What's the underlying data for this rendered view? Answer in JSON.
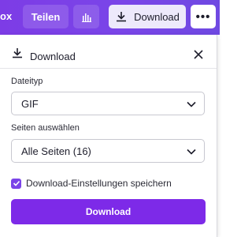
{
  "toolbar": {
    "cut_text": "ox",
    "share_label": "Teilen",
    "download_label": "Download",
    "more_label": "•••"
  },
  "panel": {
    "title": "Download",
    "file_type": {
      "label": "Dateityp",
      "value": "GIF"
    },
    "pages": {
      "label": "Seiten auswählen",
      "value": "Alle Seiten (16)"
    },
    "save_settings": {
      "label": "Download-Einstellungen speichern",
      "checked": true
    },
    "primary_button": "Download"
  },
  "colors": {
    "accent": "#7d2ae8",
    "topbar": "#7a45e8"
  }
}
